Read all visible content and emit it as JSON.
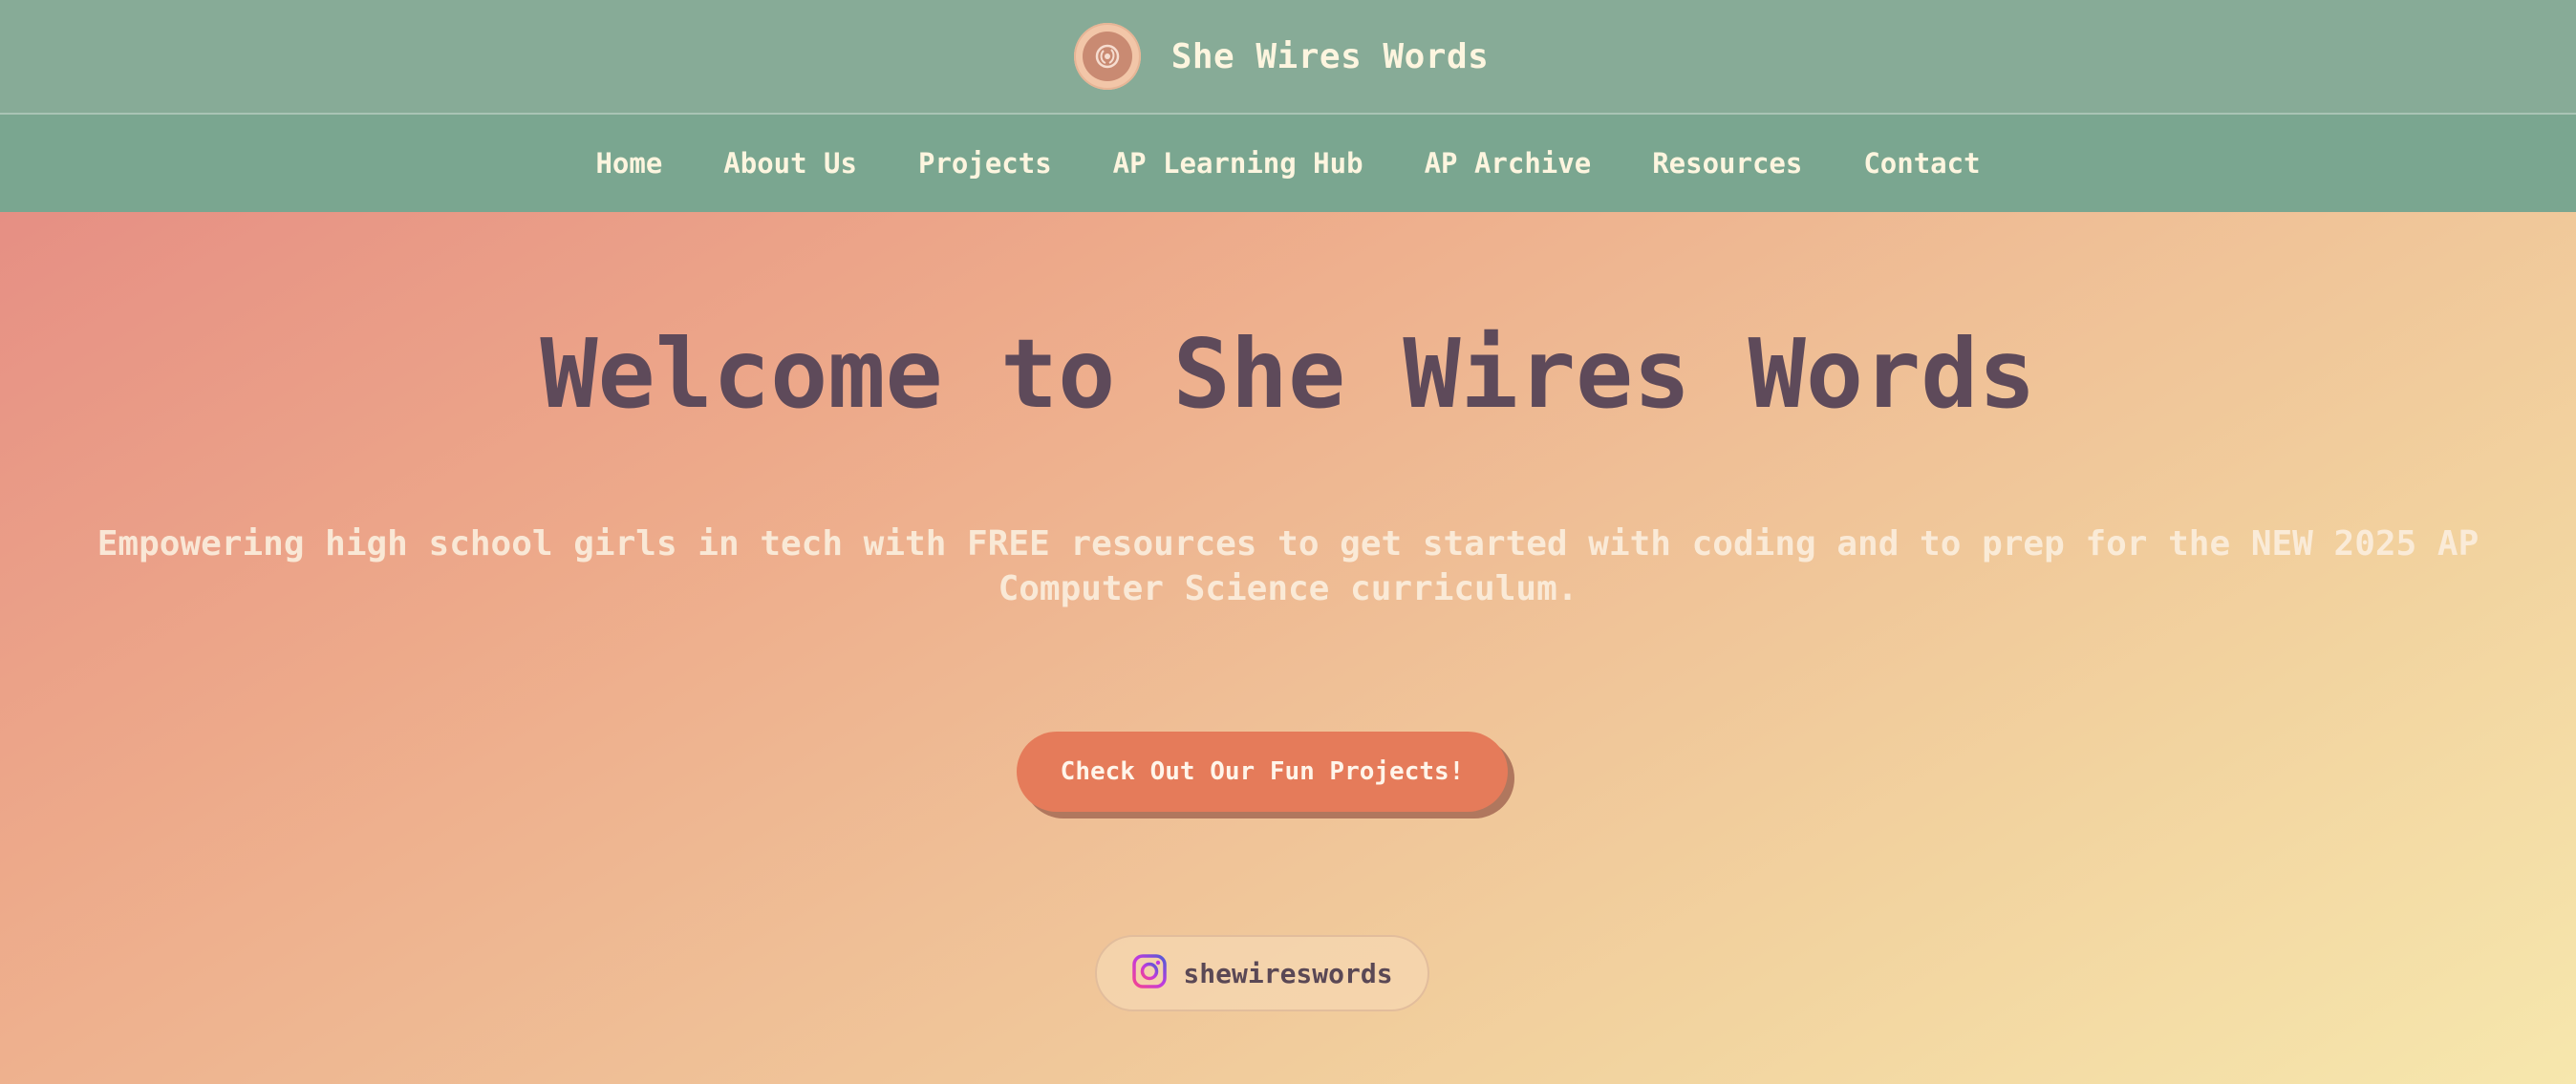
{
  "header": {
    "brand": "She Wires Words",
    "logo_icon": "circuit-logo-icon"
  },
  "nav": {
    "items": [
      {
        "label": "Home"
      },
      {
        "label": "About Us"
      },
      {
        "label": "Projects"
      },
      {
        "label": "AP Learning Hub"
      },
      {
        "label": "AP Archive"
      },
      {
        "label": "Resources"
      },
      {
        "label": "Contact"
      }
    ]
  },
  "hero": {
    "title": "Welcome to She Wires Words",
    "subtitle": "Empowering high school girls in tech with FREE resources to get started with coding and to prep for the NEW 2025 AP Computer Science curriculum.",
    "cta_label": "Check Out Our Fun Projects!",
    "social": {
      "icon": "instagram-icon",
      "handle": "shewireswords"
    }
  },
  "colors": {
    "header_bg": "#87ab97",
    "nav_bg": "#7aa690",
    "nav_text": "#fdf5df",
    "title_text": "#5e4a5a",
    "cta_bg": "#e57b5a",
    "gradient_start": "#e68f84",
    "gradient_end": "#f6e7ad"
  }
}
